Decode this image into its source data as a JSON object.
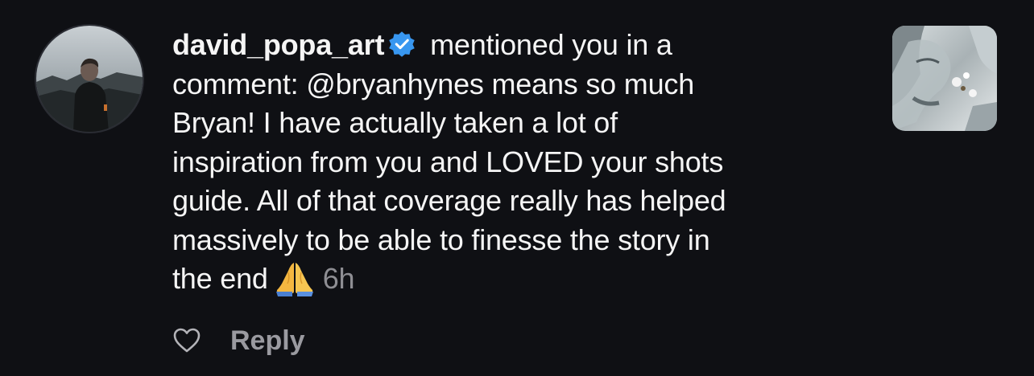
{
  "notification": {
    "username": "david_popa_art",
    "verified_icon": "verified-badge-icon",
    "lines": [
      " mentioned you in a",
      "comment: @bryanhynes means so much",
      "Bryan! I have actually taken a lot of",
      "inspiration from you and LOVED your shots",
      "guide. All of that coverage really has helped",
      "massively to be able to finesse the story in",
      "the end"
    ],
    "emoji": "folded-hands-emoji",
    "timestamp": "6h",
    "reply_label": "Reply",
    "like_icon": "heart-outline-icon"
  },
  "colors": {
    "background": "#0f1014",
    "text": "#f5f5f5",
    "muted": "#8e8e93",
    "verified_blue": "#3897f0"
  }
}
